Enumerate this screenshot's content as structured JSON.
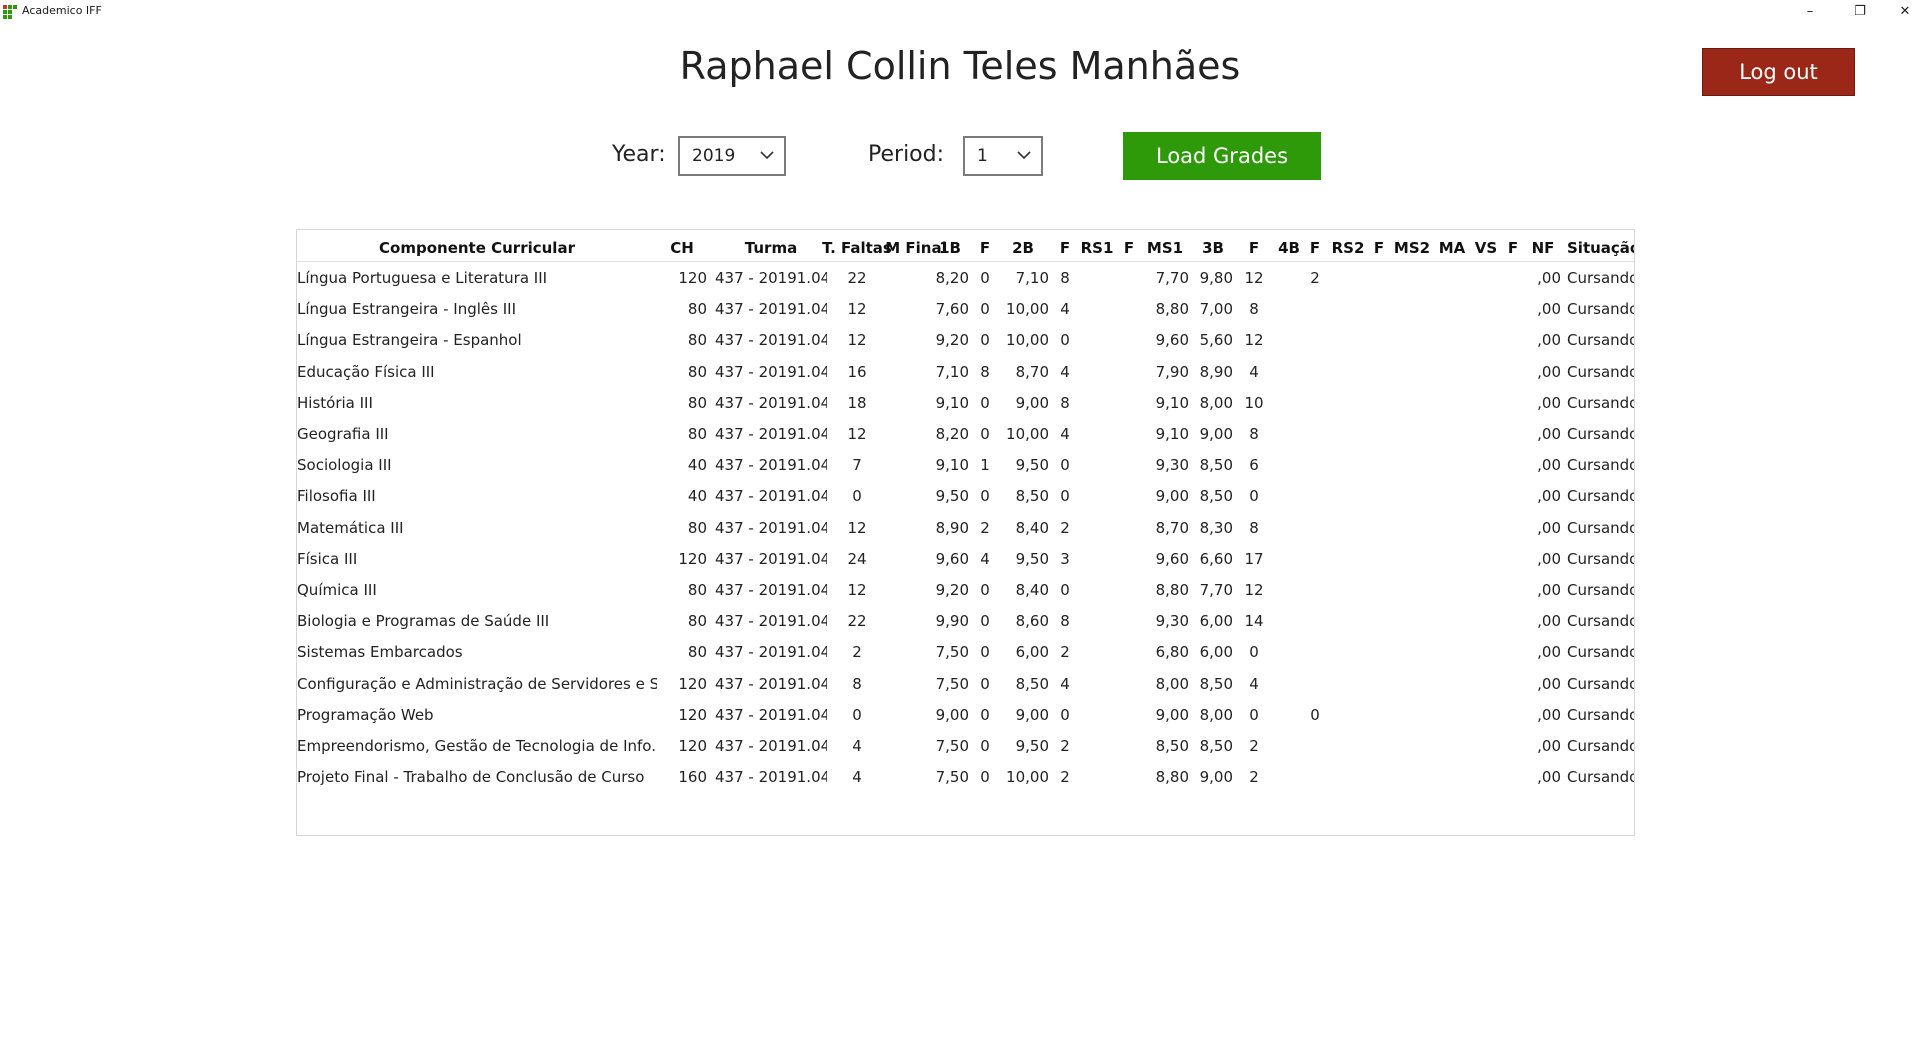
{
  "window": {
    "title": "Academico IFF",
    "minimize_glyph": "–",
    "maximize_glyph": "❐",
    "close_glyph": "✕"
  },
  "header": {
    "student_name": "Raphael Collin Teles Manhães",
    "logout_label": "Log out"
  },
  "filters": {
    "year_label": "Year:",
    "year_value": "2019",
    "period_label": "Period:",
    "period_value": "1",
    "load_label": "Load Grades"
  },
  "colors": {
    "logout_bg": "#9a2718",
    "load_bg": "#2e9a0a",
    "logo_green": "#2e9a0a",
    "logo_red": "#c0392b"
  },
  "table": {
    "columns": [
      "Componente Curricular",
      "CH",
      "Turma",
      "T. Faltas",
      "M Final",
      "1B",
      "F",
      "2B",
      "F",
      "RS1",
      "F",
      "MS1",
      "3B",
      "F",
      "4B",
      "F",
      "RS2",
      "F",
      "MS2",
      "MA",
      "VS",
      "F",
      "NF",
      "Situação"
    ],
    "rows": [
      [
        "Língua Portuguesa e Literatura III",
        "120",
        "437 - 20191.04...",
        "22",
        "",
        "8,20",
        "0",
        "7,10",
        "8",
        "",
        "",
        "7,70",
        "9,80",
        "12",
        "",
        "2",
        "",
        "",
        "",
        "",
        "",
        "",
        ",00",
        "Cursando"
      ],
      [
        "Língua Estrangeira - Inglês III",
        "80",
        "437 - 20191.04...",
        "12",
        "",
        "7,60",
        "0",
        "10,00",
        "4",
        "",
        "",
        "8,80",
        "7,00",
        "8",
        "",
        "",
        "",
        "",
        "",
        "",
        "",
        "",
        ",00",
        "Cursando"
      ],
      [
        "Língua Estrangeira - Espanhol",
        "80",
        "437 - 20191.04...",
        "12",
        "",
        "9,20",
        "0",
        "10,00",
        "0",
        "",
        "",
        "9,60",
        "5,60",
        "12",
        "",
        "",
        "",
        "",
        "",
        "",
        "",
        "",
        ",00",
        "Cursando"
      ],
      [
        "Educação Física III",
        "80",
        "437 - 20191.04...",
        "16",
        "",
        "7,10",
        "8",
        "8,70",
        "4",
        "",
        "",
        "7,90",
        "8,90",
        "4",
        "",
        "",
        "",
        "",
        "",
        "",
        "",
        "",
        ",00",
        "Cursando"
      ],
      [
        "História III",
        "80",
        "437 - 20191.04...",
        "18",
        "",
        "9,10",
        "0",
        "9,00",
        "8",
        "",
        "",
        "9,10",
        "8,00",
        "10",
        "",
        "",
        "",
        "",
        "",
        "",
        "",
        "",
        ",00",
        "Cursando"
      ],
      [
        "Geografia III",
        "80",
        "437 - 20191.04...",
        "12",
        "",
        "8,20",
        "0",
        "10,00",
        "4",
        "",
        "",
        "9,10",
        "9,00",
        "8",
        "",
        "",
        "",
        "",
        "",
        "",
        "",
        "",
        ",00",
        "Cursando"
      ],
      [
        "Sociologia III",
        "40",
        "437 - 20191.04...",
        "7",
        "",
        "9,10",
        "1",
        "9,50",
        "0",
        "",
        "",
        "9,30",
        "8,50",
        "6",
        "",
        "",
        "",
        "",
        "",
        "",
        "",
        "",
        ",00",
        "Cursando"
      ],
      [
        "Filosofia III",
        "40",
        "437 - 20191.04...",
        "0",
        "",
        "9,50",
        "0",
        "8,50",
        "0",
        "",
        "",
        "9,00",
        "8,50",
        "0",
        "",
        "",
        "",
        "",
        "",
        "",
        "",
        "",
        ",00",
        "Cursando"
      ],
      [
        "Matemática III",
        "80",
        "437 - 20191.04...",
        "12",
        "",
        "8,90",
        "2",
        "8,40",
        "2",
        "",
        "",
        "8,70",
        "8,30",
        "8",
        "",
        "",
        "",
        "",
        "",
        "",
        "",
        "",
        ",00",
        "Cursando"
      ],
      [
        "Física III",
        "120",
        "437 - 20191.04...",
        "24",
        "",
        "9,60",
        "4",
        "9,50",
        "3",
        "",
        "",
        "9,60",
        "6,60",
        "17",
        "",
        "",
        "",
        "",
        "",
        "",
        "",
        "",
        ",00",
        "Cursando"
      ],
      [
        "Química III",
        "80",
        "437 - 20191.04...",
        "12",
        "",
        "9,20",
        "0",
        "8,40",
        "0",
        "",
        "",
        "8,80",
        "7,70",
        "12",
        "",
        "",
        "",
        "",
        "",
        "",
        "",
        "",
        ",00",
        "Cursando"
      ],
      [
        "Biologia e Programas de Saúde III",
        "80",
        "437 - 20191.04...",
        "22",
        "",
        "9,90",
        "0",
        "8,60",
        "8",
        "",
        "",
        "9,30",
        "6,00",
        "14",
        "",
        "",
        "",
        "",
        "",
        "",
        "",
        "",
        ",00",
        "Cursando"
      ],
      [
        "Sistemas Embarcados",
        "80",
        "437 - 20191.04...",
        "2",
        "",
        "7,50",
        "0",
        "6,00",
        "2",
        "",
        "",
        "6,80",
        "6,00",
        "0",
        "",
        "",
        "",
        "",
        "",
        "",
        "",
        "",
        ",00",
        "Cursando"
      ],
      [
        "Configuração e Administração de Servidores e S...",
        "120",
        "437 - 20191.04...",
        "8",
        "",
        "7,50",
        "0",
        "8,50",
        "4",
        "",
        "",
        "8,00",
        "8,50",
        "4",
        "",
        "",
        "",
        "",
        "",
        "",
        "",
        "",
        ",00",
        "Cursando"
      ],
      [
        "Programação Web",
        "120",
        "437 - 20191.04...",
        "0",
        "",
        "9,00",
        "0",
        "9,00",
        "0",
        "",
        "",
        "9,00",
        "8,00",
        "0",
        "",
        "0",
        "",
        "",
        "",
        "",
        "",
        "",
        ",00",
        "Cursando"
      ],
      [
        "Empreendorismo, Gestão de Tecnologia de Info...",
        "120",
        "437 - 20191.04...",
        "4",
        "",
        "7,50",
        "0",
        "9,50",
        "2",
        "",
        "",
        "8,50",
        "8,50",
        "2",
        "",
        "",
        "",
        "",
        "",
        "",
        "",
        "",
        ",00",
        "Cursando"
      ],
      [
        "Projeto Final - Trabalho de Conclusão de Curso",
        "160",
        "437 - 20191.04...",
        "4",
        "",
        "7,50",
        "0",
        "10,00",
        "2",
        "",
        "",
        "8,80",
        "9,00",
        "2",
        "",
        "",
        "",
        "",
        "",
        "",
        "",
        "",
        ",00",
        "Cursando"
      ]
    ]
  }
}
